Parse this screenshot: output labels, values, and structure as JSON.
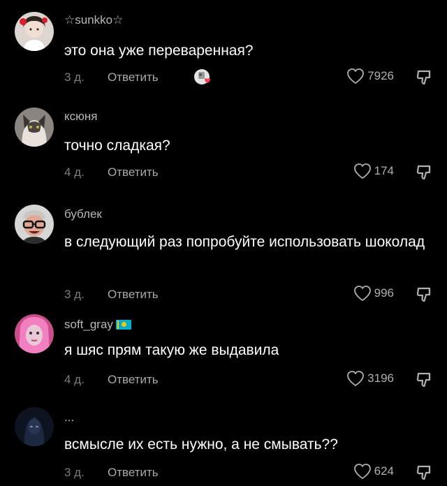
{
  "comments": [
    {
      "username": "☆sunkko☆",
      "text": "это она уже переваренная?",
      "date": "3 д.",
      "reply_label": "Ответить",
      "likes": "7926",
      "avatar": "girl-with-red-flowers",
      "sticker": "heart-sticker"
    },
    {
      "username": "ксюня",
      "text": "точно сладкая?",
      "date": "4 д.",
      "reply_label": "Ответить",
      "likes": "174",
      "avatar": "cat-photo"
    },
    {
      "username": "бублек",
      "text": "в следующий раз попробуйте использовать шоколад",
      "date": "3 д.",
      "reply_label": "Ответить",
      "likes": "996",
      "avatar": "man-with-glasses"
    },
    {
      "username": "soft_gray",
      "flag": "kazakhstan-flag",
      "text": "я шяс прям такую же выдавила",
      "date": "4 д.",
      "reply_label": "Ответить",
      "likes": "3196",
      "avatar": "pink-hair-portrait"
    },
    {
      "username": "...",
      "text": "всмысле их есть нужно, а не смывать??",
      "date": "3 д.",
      "reply_label": "Ответить",
      "likes": "624",
      "avatar": "dark-figure"
    }
  ],
  "colors": {
    "background": "#000000",
    "text": "#ffffff",
    "muted": "#8e8e8e",
    "heart_sticker": "#ff3b5c",
    "flag_blue": "#00afca",
    "flag_yellow": "#fec50c"
  }
}
